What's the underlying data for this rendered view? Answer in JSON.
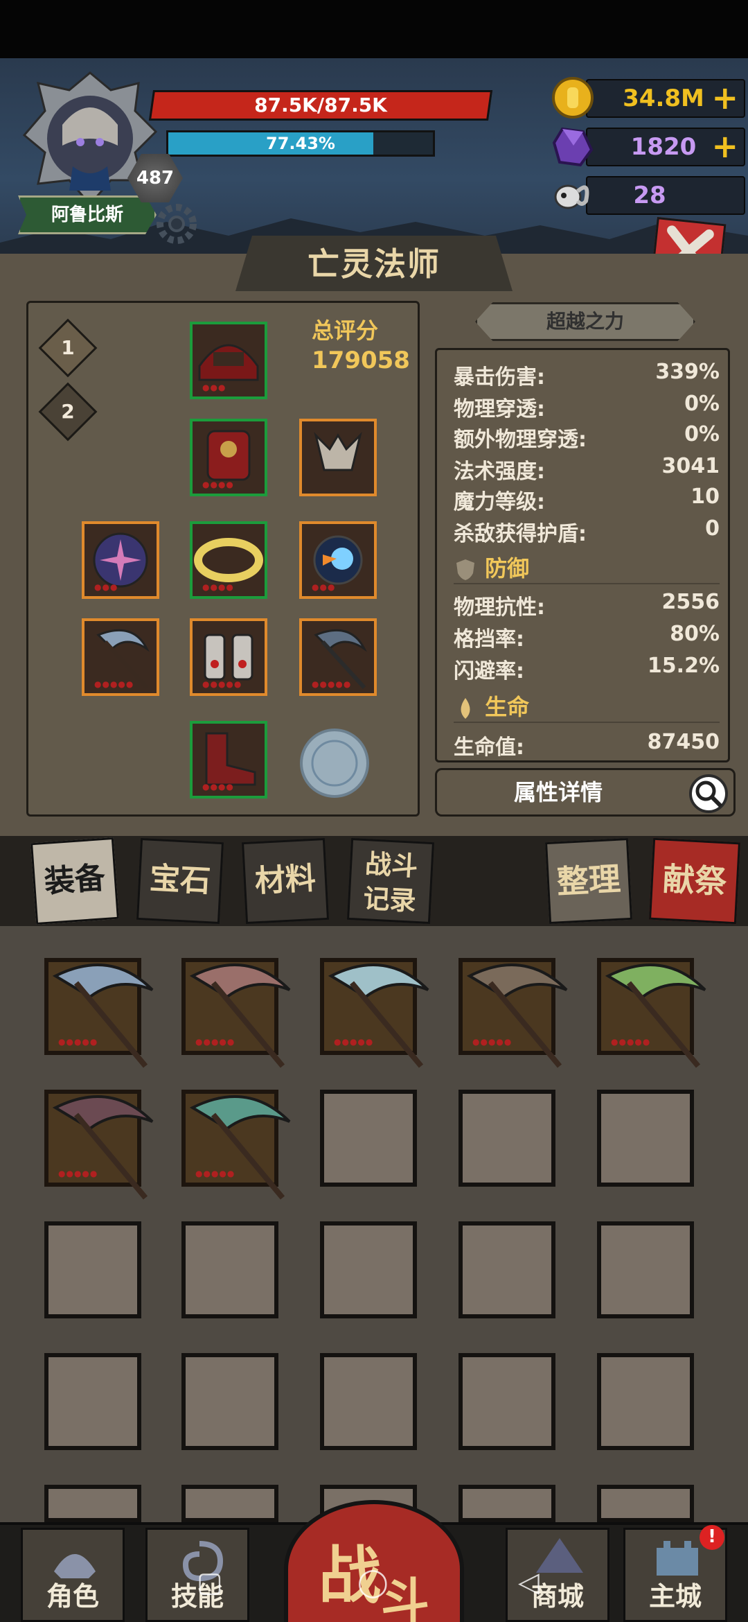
{
  "player": {
    "name": "阿鲁比斯",
    "level": "487",
    "hp_text": "87.5K/87.5K",
    "hp_fraction": 1.0,
    "exp_text": "77.43%",
    "exp_fraction": 0.7743
  },
  "resources": {
    "gold": "34.8M",
    "gems": "1820",
    "skull": "28",
    "plus": "+"
  },
  "panel": {
    "title": "亡灵法师",
    "loadout_1": "1",
    "loadout_2": "2",
    "score_label": "总评分",
    "score_value": "179058",
    "transcend_label": "超越之力",
    "detail_button": "属性详情"
  },
  "stats": {
    "attack": [
      {
        "label": "暴击伤害:",
        "value": "339%"
      },
      {
        "label": "物理穿透:",
        "value": "0%"
      },
      {
        "label": "额外物理穿透:",
        "value": "0%"
      },
      {
        "label": "法术强度:",
        "value": "3041"
      },
      {
        "label": "魔力等级:",
        "value": "10"
      },
      {
        "label": "杀敌获得护盾:",
        "value": "0"
      }
    ],
    "defense_title": "防御",
    "defense": [
      {
        "label": "物理抗性:",
        "value": "2556"
      },
      {
        "label": "格挡率:",
        "value": "80%"
      },
      {
        "label": "闪避率:",
        "value": "15.2%"
      }
    ],
    "life_title": "生命",
    "life": [
      {
        "label": "生命值:",
        "value": "87450"
      }
    ]
  },
  "tabs": {
    "equipment": "装备",
    "gems": "宝石",
    "materials": "材料",
    "battle_record_1": "战斗",
    "battle_record_2": "记录",
    "sort": "整理",
    "sacrifice": "献祭"
  },
  "nav": {
    "character": "角色",
    "skills": "技能",
    "fight_1": "战",
    "fight_2": "斗",
    "shop": "商城",
    "main_city": "主城",
    "notification": "!"
  },
  "colors": {
    "hp": "#c5261b",
    "exp": "#29a0c6",
    "accent_gold": "#f1c75a"
  }
}
